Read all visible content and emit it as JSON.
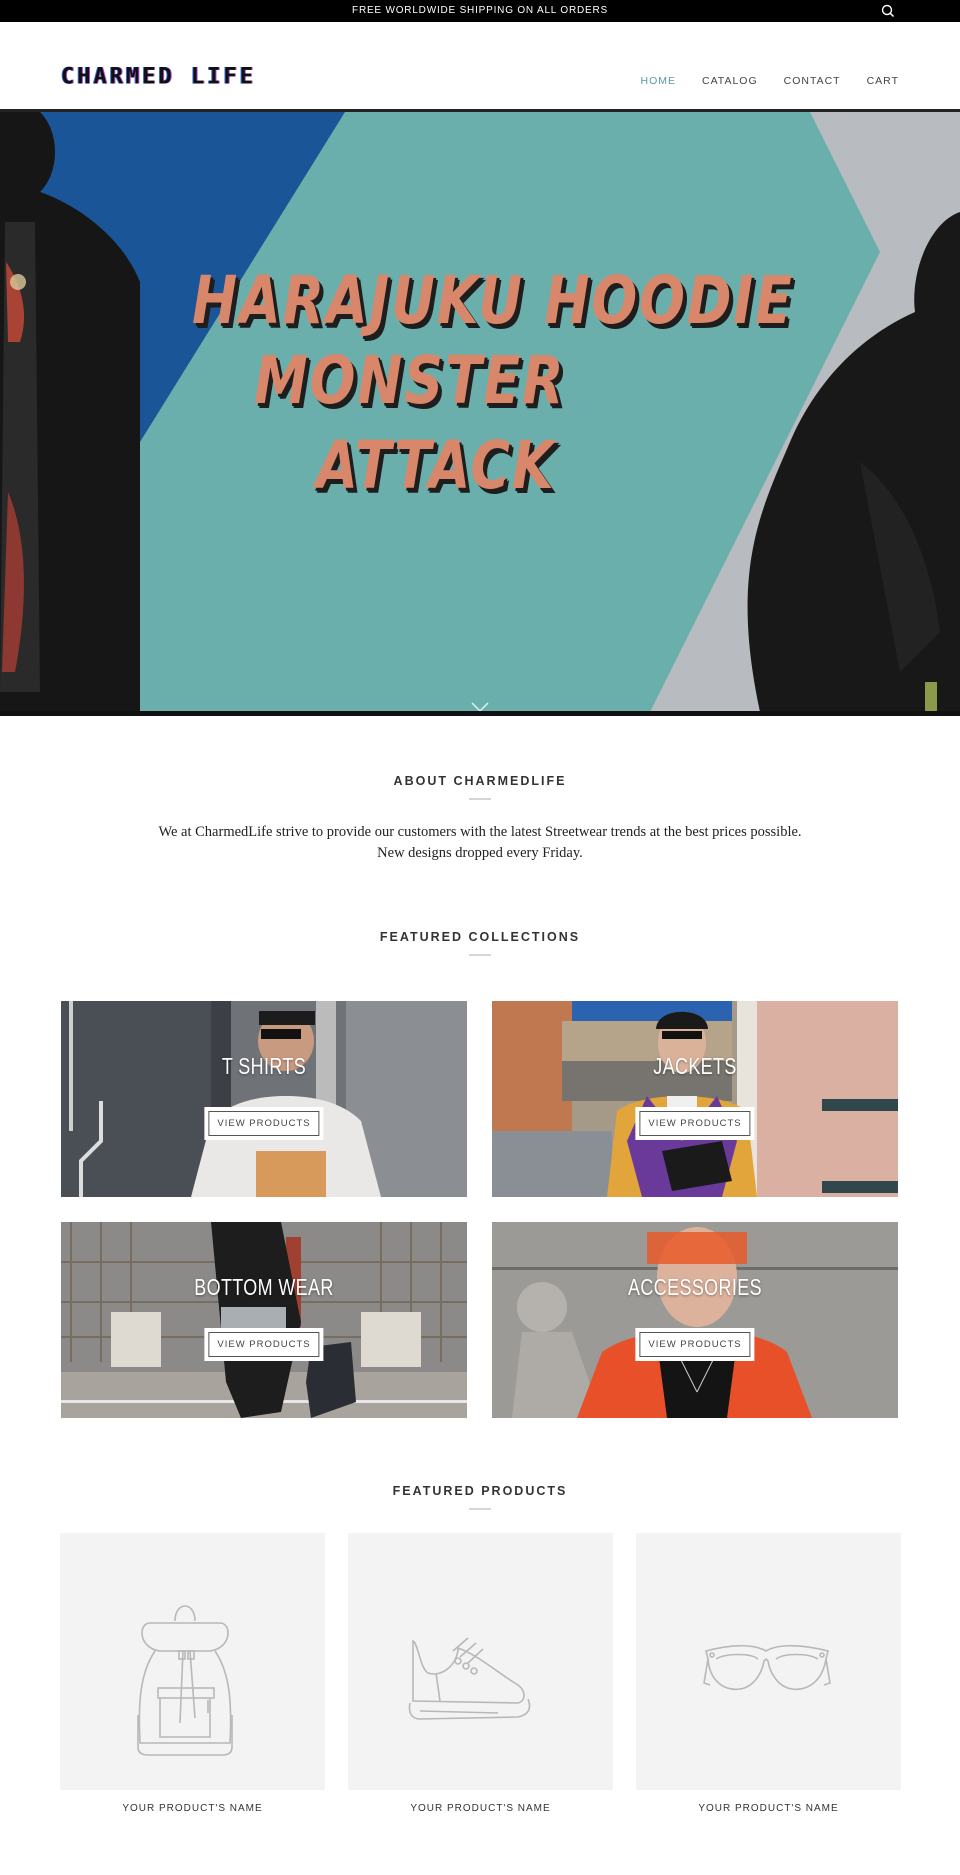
{
  "announcement": {
    "text": "FREE WORLDWIDE SHIPPING ON ALL ORDERS",
    "search_icon": "search-icon"
  },
  "header": {
    "logo": "CHARMED LIFE",
    "nav": [
      {
        "label": "HOME",
        "active": true
      },
      {
        "label": "CATALOG",
        "active": false
      },
      {
        "label": "CONTACT",
        "active": false
      },
      {
        "label": "CART",
        "active": false
      }
    ],
    "active_color": "#5b9aa0"
  },
  "hero": {
    "lines": [
      "HARAJUKU  HOODIE",
      "MONSTER",
      "ATTACK"
    ],
    "text_color": "#d9876a",
    "background_color": "#6aafab",
    "scroll_icon": "chevron-down-icon"
  },
  "about": {
    "title": "ABOUT CHARMEDLIFE",
    "line1": "We at CharmedLife strive to provide our customers with the latest Streetwear trends at the best prices possible.",
    "line2": "New designs dropped every Friday."
  },
  "collections": {
    "title": "FEATURED COLLECTIONS",
    "items": [
      {
        "title": "T SHIRTS",
        "button": "VIEW PRODUCTS"
      },
      {
        "title": "JACKETS",
        "button": "VIEW PRODUCTS"
      },
      {
        "title": "BOTTOM WEAR",
        "button": "VIEW PRODUCTS"
      },
      {
        "title": "ACCESSORIES",
        "button": "VIEW PRODUCTS"
      }
    ]
  },
  "products": {
    "title": "FEATURED PRODUCTS",
    "items": [
      {
        "name": "YOUR PRODUCT'S NAME",
        "icon": "backpack-icon"
      },
      {
        "name": "YOUR PRODUCT'S NAME",
        "icon": "sneaker-icon"
      },
      {
        "name": "YOUR PRODUCT'S NAME",
        "icon": "sunglasses-icon"
      }
    ]
  }
}
